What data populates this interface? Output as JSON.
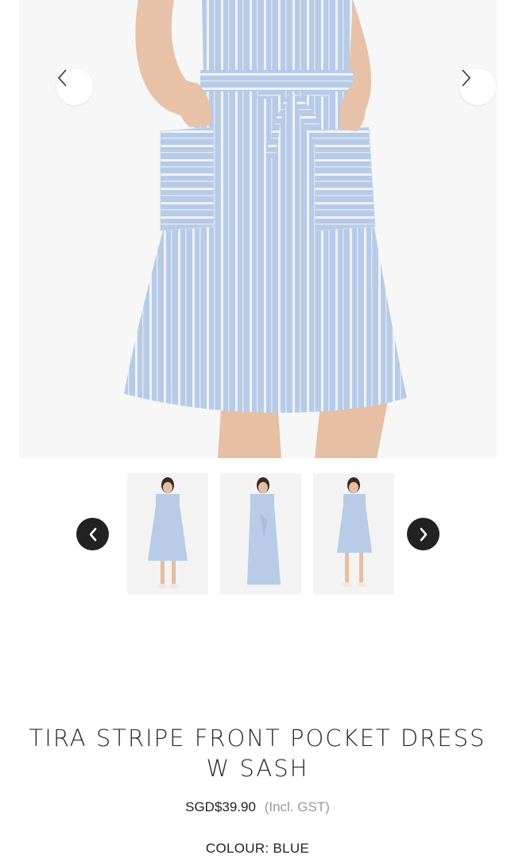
{
  "product": {
    "title_line1": "TIRA STRIPE FRONT POCKET DRESS",
    "title_line2": "W SASH",
    "price": "SGD$39.90",
    "price_note": "(Incl. GST)",
    "colour_label": "COLOUR:",
    "colour_value": "BLUE"
  },
  "gallery": {
    "main_image_name": "main-product-image",
    "thumbnail_count": 3
  },
  "colors": {
    "dress_blue": "#b9cde8",
    "stripe_white": "#eef3fa",
    "skin": "#e9c4ac",
    "nav_dark": "#222222"
  },
  "icons": {
    "prev_arrow": "chevron-left-icon",
    "next_arrow": "chevron-right-icon"
  }
}
